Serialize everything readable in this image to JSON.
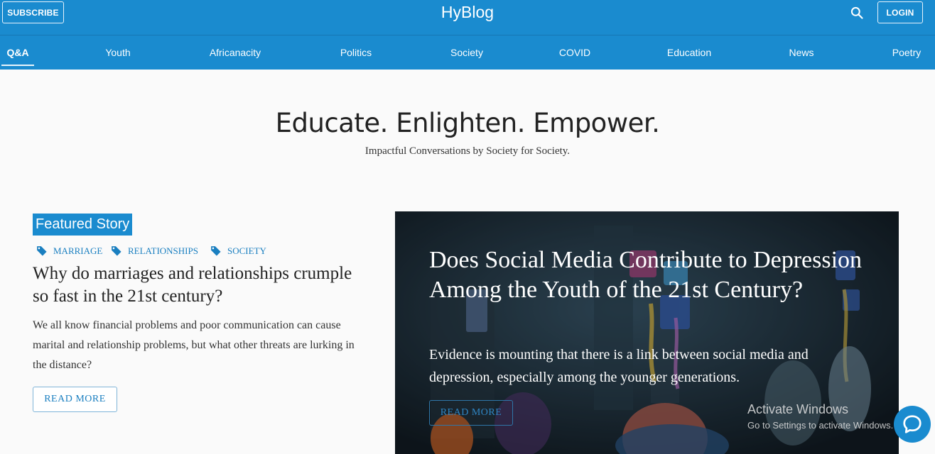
{
  "header": {
    "subscribe_label": "SUBSCRIBE",
    "brand": "HyBlog",
    "login_label": "LOGIN",
    "search_icon": "search-icon"
  },
  "nav": {
    "items": [
      "Q&A",
      "Youth",
      "Africanacity",
      "Politics",
      "Society",
      "COVID",
      "Education",
      "News",
      "Poetry"
    ],
    "active": "Q&A"
  },
  "hero": {
    "title": "Educate. Enlighten. Empower.",
    "subtitle": "Impactful Conversations by Society for Society."
  },
  "featured": {
    "badge": "Featured Story",
    "tags": [
      "MARRIAGE",
      "RELATIONSHIPS",
      "SOCIETY"
    ],
    "title": "Why do marriages and relationships crumple so fast in the 21st century?",
    "excerpt": "We all know financial problems and poor communication can cause marital and relationship problems, but what other threats are lurking in the distance?",
    "read_more": "READ MORE"
  },
  "card": {
    "title": "Does Social Media Contribute to Depression Among the Youth of the 21st Century?",
    "excerpt": "Evidence is mounting that there is a link between social media and depression, especially among the younger generations.",
    "read_more": "READ MORE"
  },
  "overlay": {
    "activate_title": "Activate Windows",
    "activate_sub": "Go to Settings to activate Windows."
  },
  "colors": {
    "brand_blue": "#1a8bcf",
    "link_blue": "#1a7fc0"
  }
}
